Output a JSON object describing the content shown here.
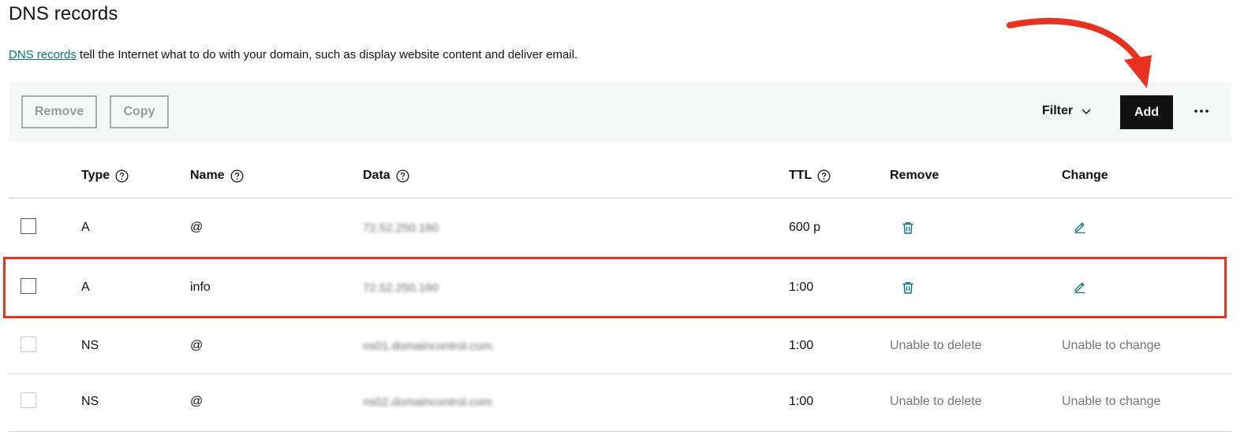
{
  "page": {
    "title": "DNS records",
    "intro_link": "DNS records",
    "intro_text": " tell the Internet what to do with your domain, such as display website content and deliver email."
  },
  "toolbar": {
    "remove_label": "Remove",
    "copy_label": "Copy",
    "filter_label": "Filter",
    "add_label": "Add",
    "more_icon": "more-horizontal-icon"
  },
  "table": {
    "headers": {
      "type": "Type",
      "name": "Name",
      "data": "Data",
      "ttl": "TTL",
      "remove": "Remove",
      "change": "Change"
    },
    "rows": [
      {
        "type": "A",
        "name": "@",
        "data": "72.52.250.160",
        "ttl": "600 p",
        "remove": "trash-icon",
        "change": "edit-icon"
      },
      {
        "type": "A",
        "name": "info",
        "data": "72.52.250.160",
        "ttl": "1:00",
        "remove": "trash-icon",
        "change": "edit-icon"
      },
      {
        "type": "NS",
        "name": "@",
        "data": "ns01.domaincontrol.com.",
        "ttl": "1:00",
        "remove": "Unable to delete",
        "change": "Unable to change"
      },
      {
        "type": "NS",
        "name": "@",
        "data": "ns02.domaincontrol.com.",
        "ttl": "1:00",
        "remove": "Unable to delete",
        "change": "Unable to change"
      }
    ]
  },
  "colors": {
    "link": "#09757a",
    "action_icon": "#09757a",
    "annotation": "#e8321f",
    "add_button_bg": "#111111",
    "toolbar_bg": "#f5f6f6"
  }
}
